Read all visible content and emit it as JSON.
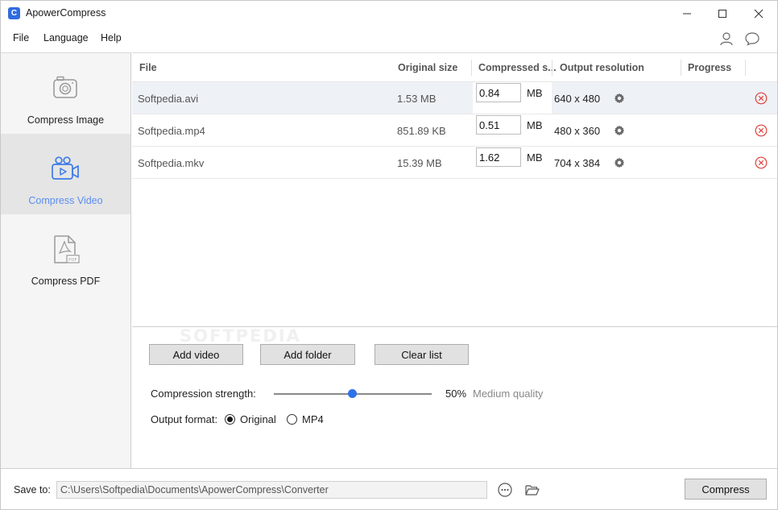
{
  "window": {
    "title": "ApowerCompress",
    "app_icon_letter": "C",
    "controls": [
      "minimize",
      "maximize",
      "close"
    ]
  },
  "menu": {
    "items": [
      "File",
      "Language",
      "Help"
    ],
    "icons": [
      "user-icon",
      "chat-icon"
    ]
  },
  "sidebar": {
    "items": [
      {
        "label": "Compress Image",
        "icon": "camera-icon",
        "active": false
      },
      {
        "label": "Compress Video",
        "icon": "video-camera-icon",
        "active": true
      },
      {
        "label": "Compress PDF",
        "icon": "pdf-icon",
        "active": false
      }
    ]
  },
  "table": {
    "headers": [
      "File",
      "Original size",
      "Compressed s...",
      "Output resolution",
      "Progress"
    ],
    "unit": "MB",
    "rows": [
      {
        "file": "Softpedia.avi",
        "original_size": "1.53 MB",
        "compressed": "0.84",
        "resolution": "640 x 480"
      },
      {
        "file": "Softpedia.mp4",
        "original_size": "851.89 KB",
        "compressed": "0.51",
        "resolution": "480 x 360"
      },
      {
        "file": "Softpedia.mkv",
        "original_size": "15.39 MB",
        "compressed": "1.62",
        "resolution": "704 x 384"
      }
    ]
  },
  "controls": {
    "add_video": "Add video",
    "add_folder": "Add folder",
    "clear_list": "Clear list",
    "strength_label": "Compression strength:",
    "strength_value": "50%",
    "strength_fraction": 0.5,
    "quality_label": "Medium quality",
    "format_label": "Output format:",
    "format_options": [
      "Original",
      "MP4"
    ],
    "format_selected": "Original"
  },
  "watermark": "SOFTPEDIA",
  "footer": {
    "save_to_label": "Save to:",
    "path": "C:\\Users\\Softpedia\\Documents\\ApowerCompress\\Converter",
    "compress_button": "Compress"
  },
  "colors": {
    "accent": "#2f72e8",
    "active_sidebar_text": "#5b8def",
    "remove_red": "#e0403a"
  }
}
